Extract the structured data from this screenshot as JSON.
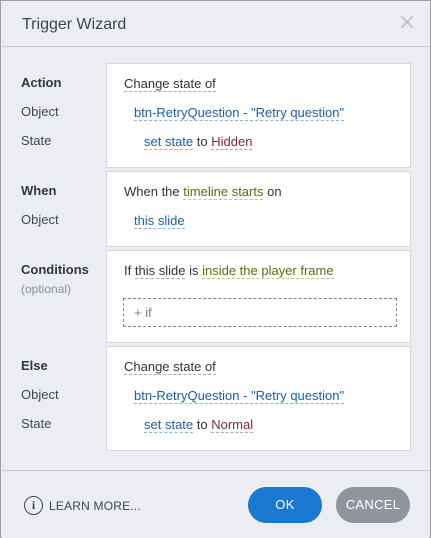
{
  "dialog": {
    "title": "Trigger Wizard",
    "close_icon": "close-icon"
  },
  "action": {
    "label_action": "Action",
    "label_object": "Object",
    "label_state": "State",
    "verb": "Change state of",
    "object": "btn-RetryQuestion - \"Retry question\"",
    "set_state": "set state",
    "to": "to",
    "state": "Hidden"
  },
  "when": {
    "label_when": "When",
    "label_object": "Object",
    "prefix": "When the",
    "event": "timeline starts",
    "on": "on",
    "object": "this slide"
  },
  "conditions": {
    "label": "Conditions",
    "sublabel": "(optional)",
    "prefix": "If",
    "subject": "this slide",
    "is": "is",
    "condition": "inside the player frame",
    "add_if": "+ if"
  },
  "else": {
    "label_else": "Else",
    "label_object": "Object",
    "label_state": "State",
    "verb": "Change state of",
    "object": "btn-RetryQuestion - \"Retry question\"",
    "set_state": "set state",
    "to": "to",
    "state": "Normal"
  },
  "footer": {
    "learn_more": "LEARN MORE...",
    "info_glyph": "i",
    "ok": "OK",
    "cancel": "CANCEL"
  },
  "colors": {
    "accent": "#1b78d0",
    "cancel": "#8e959c",
    "background": "#ebedf0"
  }
}
